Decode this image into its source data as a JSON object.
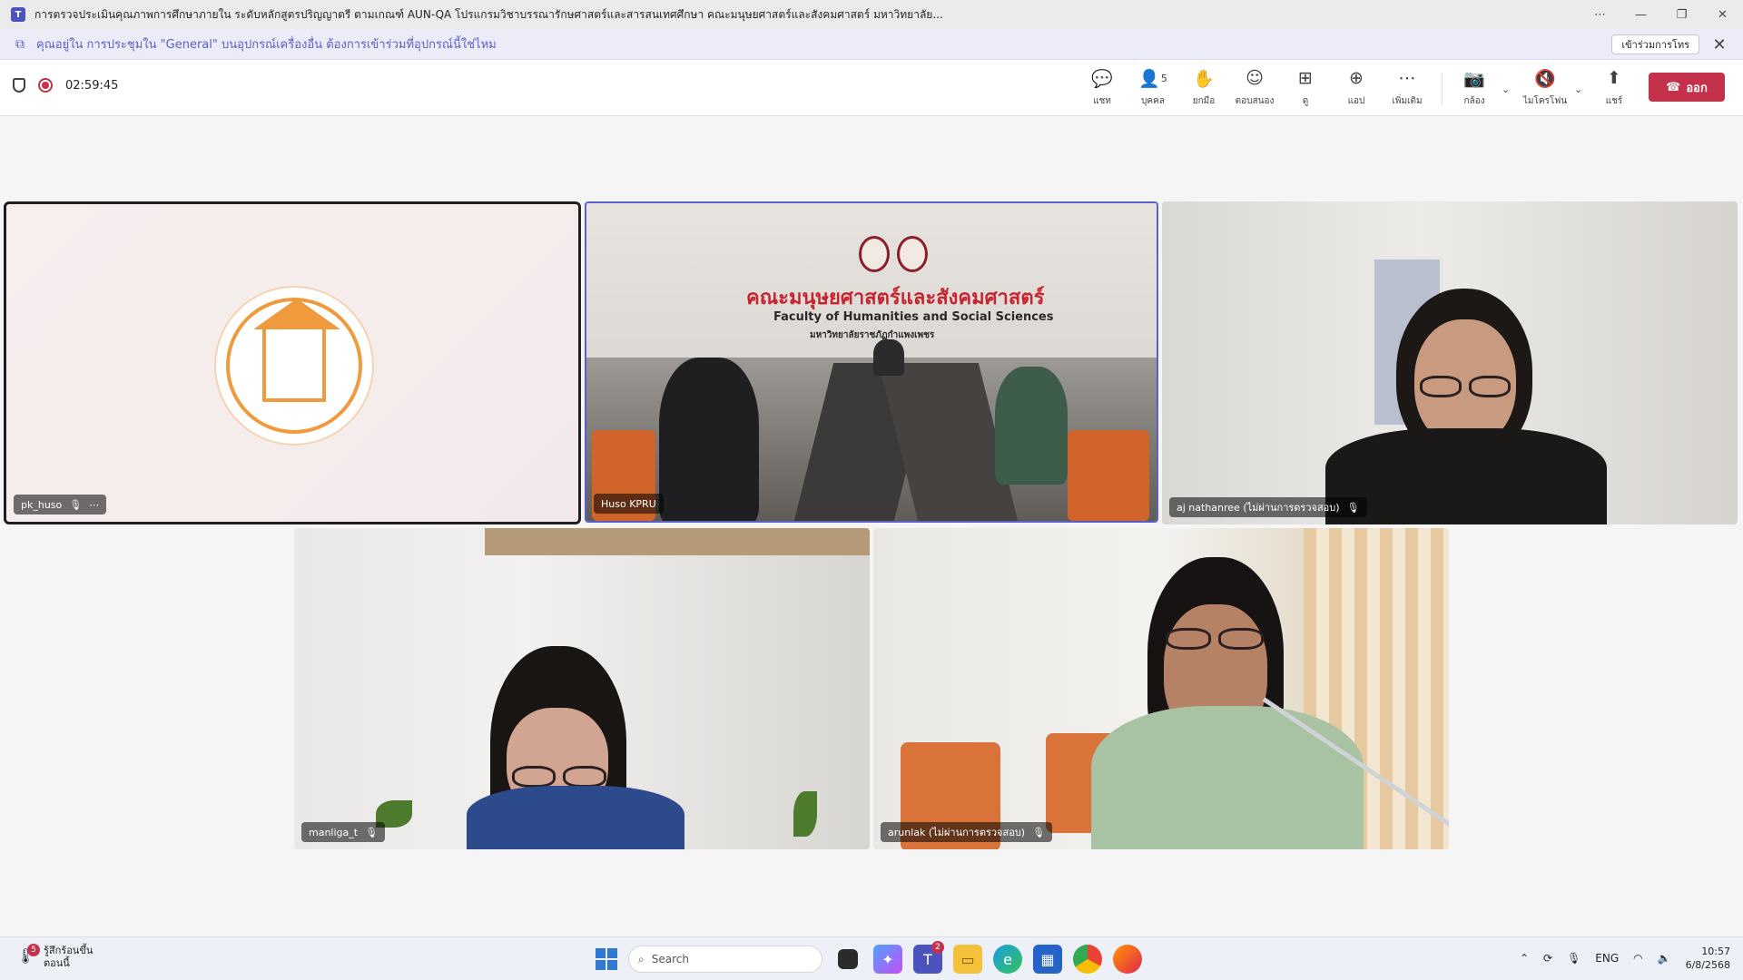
{
  "window": {
    "title": "การตรวจประเมินคุณภาพการศึกษาภายใน ระดับหลักสูตรปริญญาตรี ตามเกณฑ์ AUN-QA โปรแกรมวิชาบรรณารักษศาสตร์และสารสนเทศศึกษา คณะมนุษยศาสตร์และสังคมศาสตร์ มหาวิทยาลัย...",
    "more": "⋯",
    "minimize": "—",
    "maximize": "❐",
    "close": "✕"
  },
  "banner": {
    "text": "คุณอยู่ใน การประชุมใน \"General\" บนอุปกรณ์เครื่องอื่น ต้องการเข้าร่วมที่อุปกรณ์นี้ใช่ไหม",
    "join_label": "เข้าร่วมการโทร",
    "close": "✕"
  },
  "meeting": {
    "timer": "02:59:45",
    "chat_label": "แชท",
    "people_label": "บุคคล",
    "people_count": "5",
    "raise_label": "ยกมือ",
    "react_label": "ตอบสนอง",
    "view_label": "ดู",
    "apps_label": "แอป",
    "more_label": "เพิ่มเติม",
    "camera_label": "กล้อง",
    "mic_label": "ไมโครโฟน",
    "share_label": "แชร์",
    "leave_label": "ออก"
  },
  "participants": [
    {
      "name": "pk_huso"
    },
    {
      "name": "Huso KPRU"
    },
    {
      "name": "aj nathanree (ไม่ผ่านการตรวจสอบ)"
    },
    {
      "name": "manliga_t"
    },
    {
      "name": "arunlak (ไม่ผ่านการตรวจสอบ)"
    }
  ],
  "room_sign": {
    "thai": "คณะมนุษยศาสตร์และสังคมศาสตร์",
    "english": "Faculty of Humanities and Social Sciences",
    "university": "มหาวิทยาลัยราชภัฏกำแพงเพชร"
  },
  "taskbar": {
    "weather_line1": "รู้สึกร้อนขึ้น",
    "weather_line2": "ตอนนี้",
    "weather_badge": "5",
    "search_placeholder": "Search",
    "teams_badge": "2",
    "lang": "ENG",
    "time": "10:57",
    "date": "6/8/2568"
  },
  "colors": {
    "accent": "#5b5fc7",
    "leave": "#c4314b"
  }
}
